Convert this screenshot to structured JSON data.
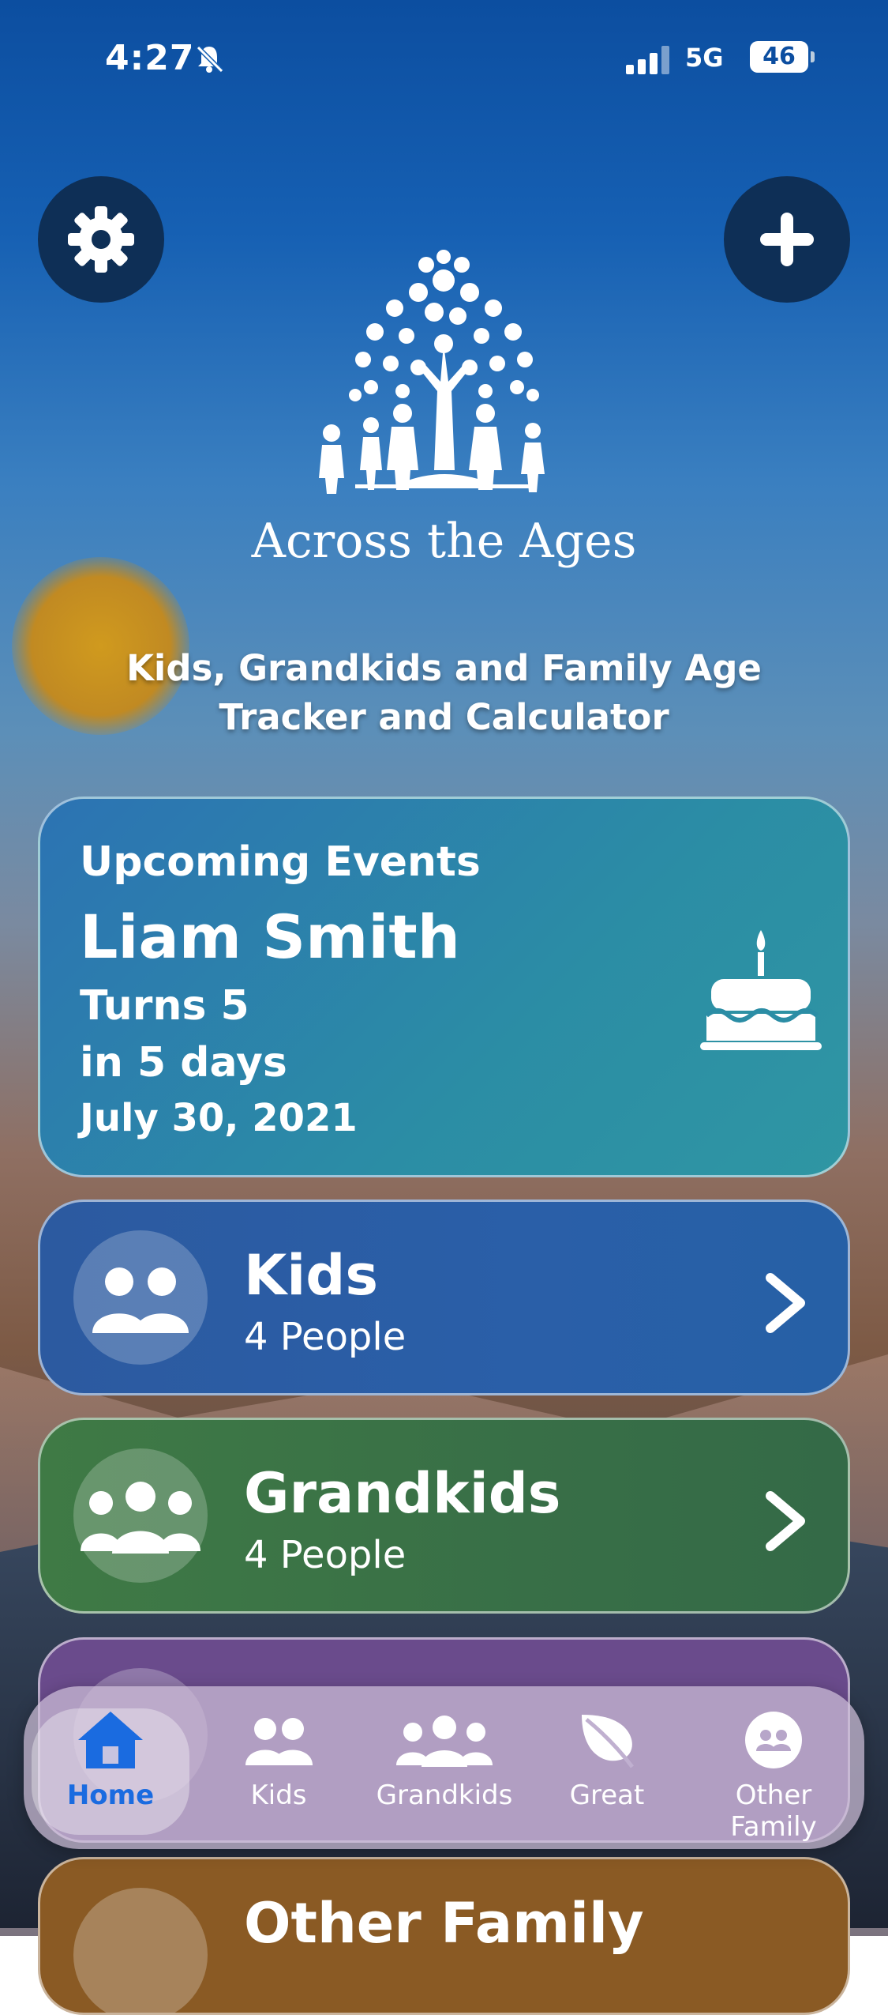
{
  "status_bar": {
    "time": "4:27",
    "network": "5G",
    "battery": "46"
  },
  "header": {
    "settings_icon": "gear-icon",
    "add_icon": "plus-icon",
    "logo_text": "Across the Ages",
    "subtitle": "Kids, Grandkids and Family Age Tracker and Calculator"
  },
  "upcoming": {
    "label": "Upcoming Events",
    "name": "Liam Smith",
    "turns": "Turns 5",
    "in_days": "in 5 days",
    "date": "July 30, 2021",
    "icon": "cake-icon"
  },
  "groups": [
    {
      "title": "Kids",
      "count": "4 People",
      "color": "#2c5aa0"
    },
    {
      "title": "Grandkids",
      "count": "4 People",
      "color": "#3f7a45"
    },
    {
      "title": "",
      "count": "",
      "color": "#6a4b8c"
    },
    {
      "title": "Other Family",
      "count": "",
      "color": "#8a5a24"
    }
  ],
  "tabbar": {
    "tabs": [
      {
        "label": "Home",
        "icon": "home-icon",
        "active": true
      },
      {
        "label": "Kids",
        "icon": "two-people-icon"
      },
      {
        "label": "Grandkids",
        "icon": "three-people-icon"
      },
      {
        "label": "Great",
        "icon": "leaf-icon"
      },
      {
        "label": "Other Family",
        "icon": "people-circle-icon"
      }
    ],
    "accent": "#1a6be0"
  }
}
